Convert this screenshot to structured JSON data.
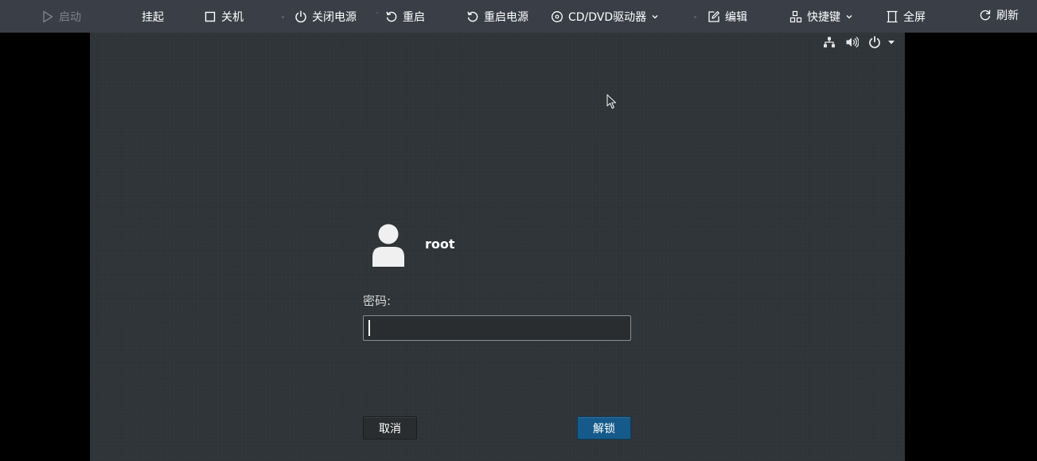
{
  "toolbar": {
    "start": "启动",
    "suspend": "挂起",
    "shutdown": "关机",
    "power_off": "关闭电源",
    "restart": "重启",
    "power_cycle": "重启电源",
    "cd_dvd": "CD/DVD驱动器",
    "edit": "编辑",
    "shortcuts": "快捷键",
    "fullscreen": "全屏",
    "refresh": "刷新"
  },
  "login": {
    "username": "root",
    "password_label": "密码:",
    "password_value": "",
    "cancel": "取消",
    "unlock": "解锁"
  },
  "colors": {
    "toolbar_bg": "#3a3f47",
    "screen_bg": "#2e3437",
    "unlock_button": "#155a8a"
  },
  "icons": {
    "top_right": [
      "network-icon",
      "volume-icon",
      "power-icon",
      "dropdown-arrow-icon"
    ]
  }
}
